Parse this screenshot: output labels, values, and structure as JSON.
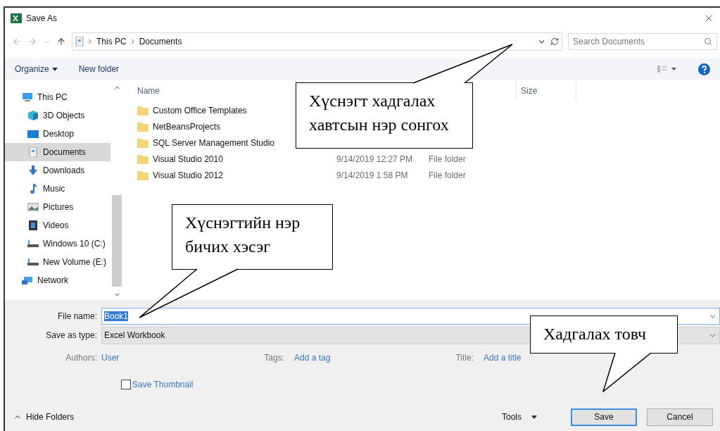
{
  "window": {
    "title": "Save As"
  },
  "address_bar": {
    "path": [
      "This PC",
      "Documents"
    ]
  },
  "search": {
    "placeholder": "Search Documents"
  },
  "toolbar": {
    "organize": "Organize",
    "new_folder": "New folder"
  },
  "sidebar": {
    "items": [
      {
        "label": "This PC",
        "kind": "pc",
        "selected": false,
        "children": [
          {
            "label": "3D Objects",
            "kind": "cube",
            "selected": false
          },
          {
            "label": "Desktop",
            "kind": "desktop",
            "selected": false
          },
          {
            "label": "Documents",
            "kind": "document",
            "selected": true
          },
          {
            "label": "Downloads",
            "kind": "download",
            "selected": false
          },
          {
            "label": "Music",
            "kind": "music",
            "selected": false
          },
          {
            "label": "Pictures",
            "kind": "pictures",
            "selected": false
          },
          {
            "label": "Videos",
            "kind": "video",
            "selected": false
          },
          {
            "label": "Windows 10 (C:)",
            "kind": "drive",
            "selected": false
          },
          {
            "label": "New Volume (E:)",
            "kind": "drive",
            "selected": false
          }
        ]
      },
      {
        "label": "Network",
        "kind": "network",
        "selected": false
      }
    ]
  },
  "file_list": {
    "columns": {
      "name": "Name",
      "size": "Size"
    },
    "rows": [
      {
        "name": "Custom Office Templates"
      },
      {
        "name": "NetBeansProjects"
      },
      {
        "name": "SQL Server Management Studio"
      },
      {
        "name": "Visual Studio 2010",
        "date": "9/14/2019 12:27 PM",
        "type": "File folder"
      },
      {
        "name": "Visual Studio 2012",
        "date": "9/14/2019 1:58 PM",
        "type": "File folder"
      }
    ]
  },
  "form": {
    "file_name": {
      "label": "File name:",
      "value": "Book1"
    },
    "save_as_type": {
      "label": "Save as type:",
      "value": "Excel Workbook"
    },
    "meta": [
      {
        "label": "Authors:",
        "value": "User"
      },
      {
        "label": "Tags:",
        "value": "Add a tag"
      },
      {
        "label": "Title:",
        "value": "Add a title"
      }
    ],
    "save_thumbnail": {
      "label": "Save Thumbnail",
      "checked": false
    }
  },
  "footer": {
    "hide_folders": "Hide Folders",
    "tools": "Tools",
    "buttons": [
      {
        "label": "Save",
        "default": true
      },
      {
        "label": "Cancel",
        "default": false
      }
    ]
  },
  "callouts": [
    {
      "text": "Хүснэгт хадгалах\nхавтсын нэр сонгох"
    },
    {
      "text": "Хүснэгтийн нэр\nбичих хэсэг"
    },
    {
      "text": "Хадгалах товч"
    }
  ]
}
